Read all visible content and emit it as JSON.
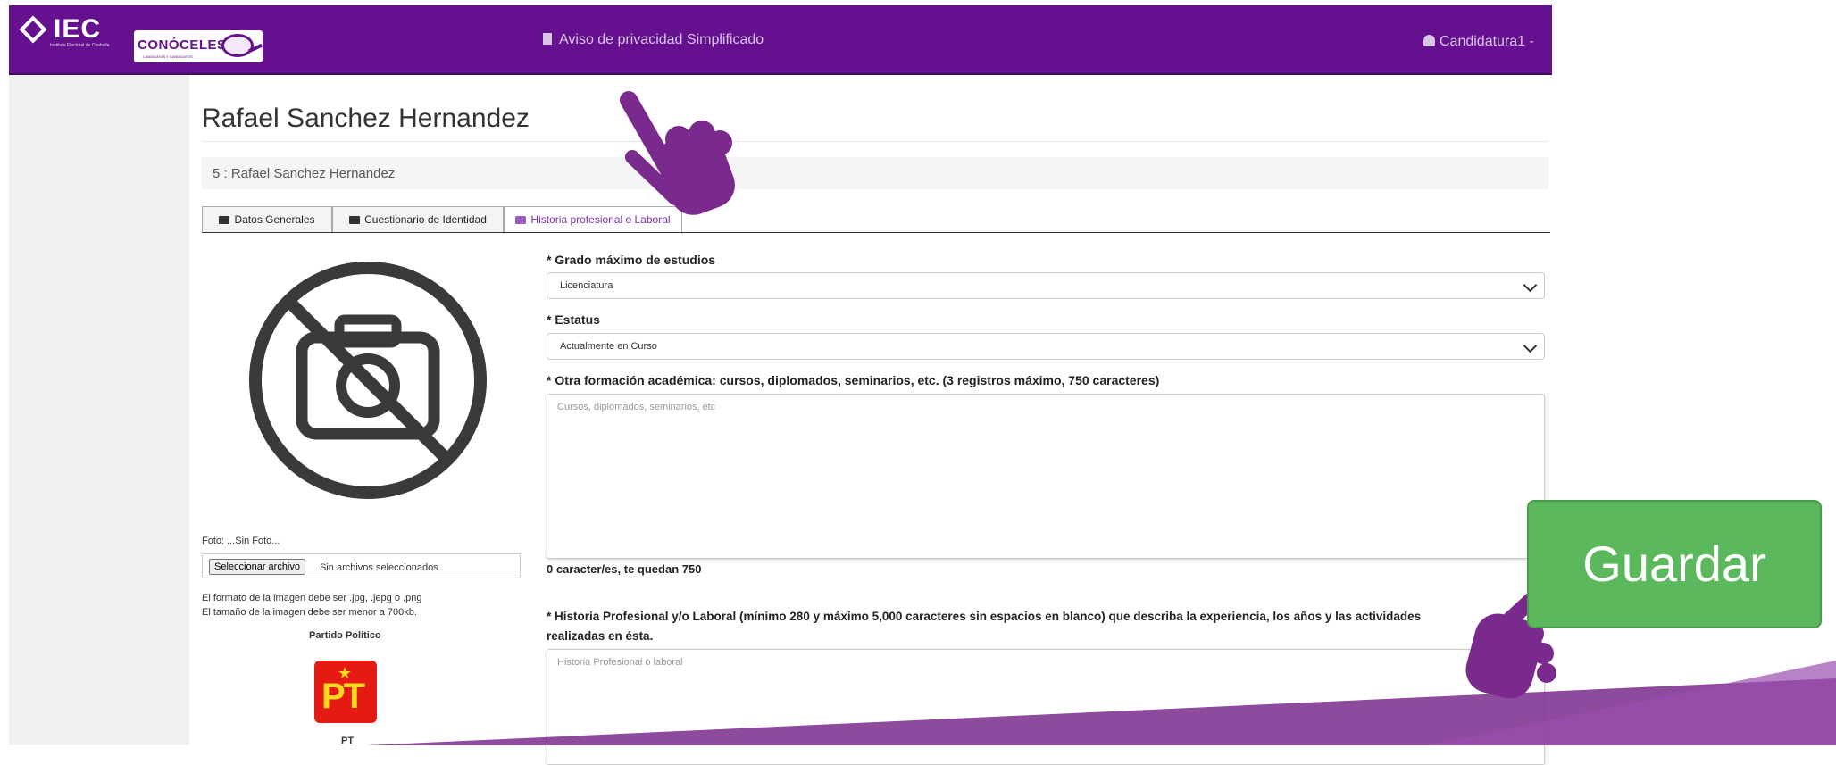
{
  "navbar": {
    "logo_text": "IEC",
    "logo_subtext": "Instituto Electoral de Coahuila",
    "app_logo_text": "CONÓCELES",
    "app_logo_subtext": "CANDIDATAS Y CANDIDATOS",
    "center_link": "Aviso de privacidad Simplificado",
    "user_menu": "Candidatura1 -",
    "icons": {
      "center": "document-icon",
      "user": "user-icon"
    },
    "color": "#65108f"
  },
  "page": {
    "title": "Rafael Sanchez Hernandez",
    "breadcrumb": "5 : Rafael Sanchez Hernandez"
  },
  "tabs": [
    {
      "label": "Datos Generales",
      "icon": "id-card-icon",
      "active": false
    },
    {
      "label": "Cuestionario de Identidad",
      "icon": "id-card-icon",
      "active": false
    },
    {
      "label": "Historia profesional o Laboral",
      "icon": "folder-open-icon",
      "active": true
    }
  ],
  "form": {
    "grado_label": "* Grado máximo de estudios",
    "grado_value": "Licenciatura",
    "estatus_label": "* Estatus",
    "estatus_value": "Actualmente en Curso",
    "otra_label": "* Otra formación académica: cursos, diplomados, seminarios, etc. (3 registros máximo, 750 caracteres)",
    "otra_placeholder": "Cursos, diplomados, seminarios, etc",
    "otra_counter": "0 caracter/es, te quedan 750",
    "historia_label_line1": "* Historia Profesional y/o Laboral (mínimo 280 y máximo 5,000 caracteres sin espacios en blanco) que describa la experiencia, los años y las actividades",
    "historia_label_line2": "realizadas en ésta.",
    "historia_placeholder": "Historia Profesional o laboral"
  },
  "sidebar": {
    "photo_label": "Foto: ...Sin Foto...",
    "file_button": "Seleccionar archivo",
    "file_none": "Sin archivos seleccionados",
    "format_note": "El formato de la imagen debe ser .jpg, .jepg o .png",
    "size_note": "El tamaño de la imagen debe ser menor a 700kb.",
    "party_heading": "Partido Político",
    "party_logo_text": "PT",
    "party_name": "PT",
    "party_color": "#e41a13"
  },
  "overlay": {
    "save_button": "Guardar",
    "save_color": "#5cb85c",
    "pointer_color": "#7a2a8c"
  }
}
